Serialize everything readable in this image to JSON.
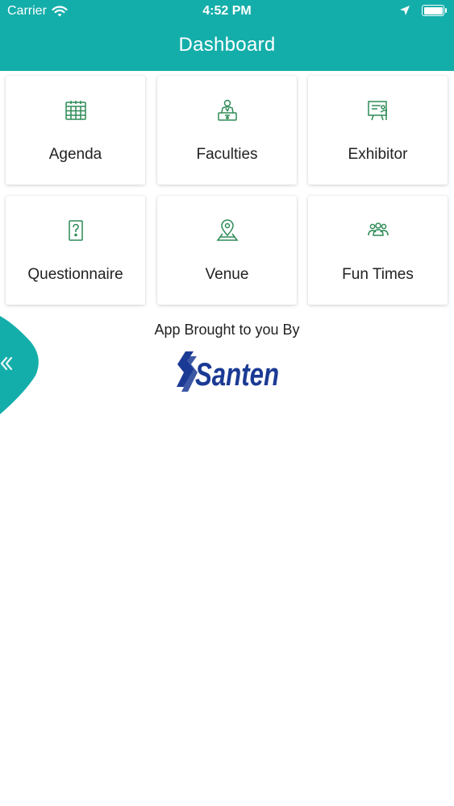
{
  "status_bar": {
    "carrier": "Carrier",
    "time": "4:52 PM",
    "icons": [
      "wifi-icon",
      "location-arrow-icon",
      "battery-icon"
    ]
  },
  "header": {
    "title": "Dashboard",
    "color": "#14aeaa"
  },
  "tiles": [
    {
      "label": "Agenda",
      "icon": "calendar-icon"
    },
    {
      "label": "Faculties",
      "icon": "speaker-podium-icon"
    },
    {
      "label": "Exhibitor",
      "icon": "presentation-board-icon"
    },
    {
      "label": "Questionnaire",
      "icon": "question-card-icon"
    },
    {
      "label": "Venue",
      "icon": "map-pin-icon"
    },
    {
      "label": "Fun Times",
      "icon": "group-people-icon"
    }
  ],
  "sponsor": {
    "caption": "App Brought to you By",
    "logo_text": "Santen",
    "logo_color": "#1a3a94"
  },
  "side_drawer": {
    "icon": "double-chevron-left-icon"
  },
  "colors": {
    "icon_green": "#2e8b57",
    "accent_teal": "#14aeaa"
  }
}
